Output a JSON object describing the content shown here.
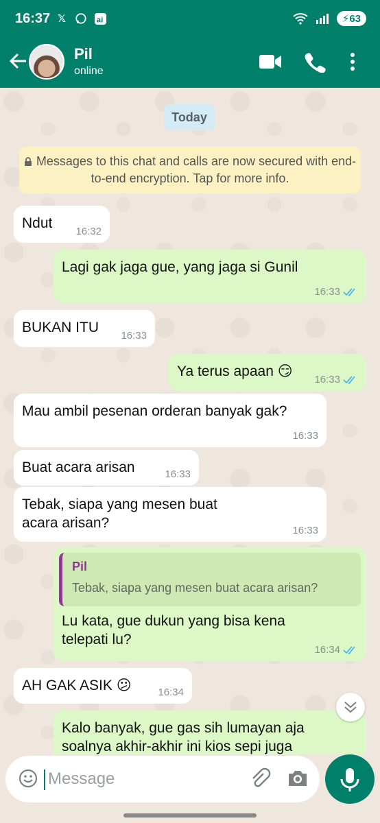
{
  "status_bar": {
    "time": "16:37",
    "battery": "63",
    "app_icons": [
      "x-icon",
      "whatsapp-icon",
      "ai-icon"
    ]
  },
  "header": {
    "contact_name": "Pil",
    "contact_status": "online"
  },
  "chat": {
    "date_label": "Today",
    "encryption_notice": "Messages to this chat and calls are now secured with end-to-end encryption. Tap for more info.",
    "messages": [
      {
        "direction": "in",
        "text": "Ndut",
        "time": "16:32"
      },
      {
        "direction": "out",
        "text": "Lagi gak jaga gue, yang jaga si Gunil",
        "time": "16:33",
        "status": "read"
      },
      {
        "direction": "in",
        "text": "BUKAN ITU",
        "time": "16:33"
      },
      {
        "direction": "out",
        "text": "Ya terus apaan 😏",
        "time": "16:33",
        "status": "read"
      },
      {
        "direction": "in",
        "text": "Mau ambil pesenan orderan banyak gak?",
        "time": "16:33"
      },
      {
        "direction": "in",
        "text": "Buat acara arisan",
        "time": "16:33"
      },
      {
        "direction": "in",
        "text": "Tebak, siapa yang mesen buat acara arisan?",
        "time": "16:33"
      },
      {
        "direction": "out",
        "quote_name": "Pil",
        "quote_text": "Tebak, siapa yang mesen buat acara arisan?",
        "text": "Lu kata, gue dukun yang bisa kena telepati lu?",
        "time": "16:34",
        "status": "read"
      },
      {
        "direction": "in",
        "text": "AH GAK ASIK 😕",
        "time": "16:34"
      },
      {
        "direction": "out",
        "text": "Kalo banyak, gue gas sih lumayan aja soalnya akhir-akhir ini kios sepi juga",
        "time": ""
      }
    ]
  },
  "composer": {
    "placeholder": "Message"
  },
  "colors": {
    "header": "#00806a",
    "outgoing_bubble": "#dcf8c6",
    "incoming_bubble": "#ffffff",
    "read_ticks": "#4fb6ec"
  }
}
